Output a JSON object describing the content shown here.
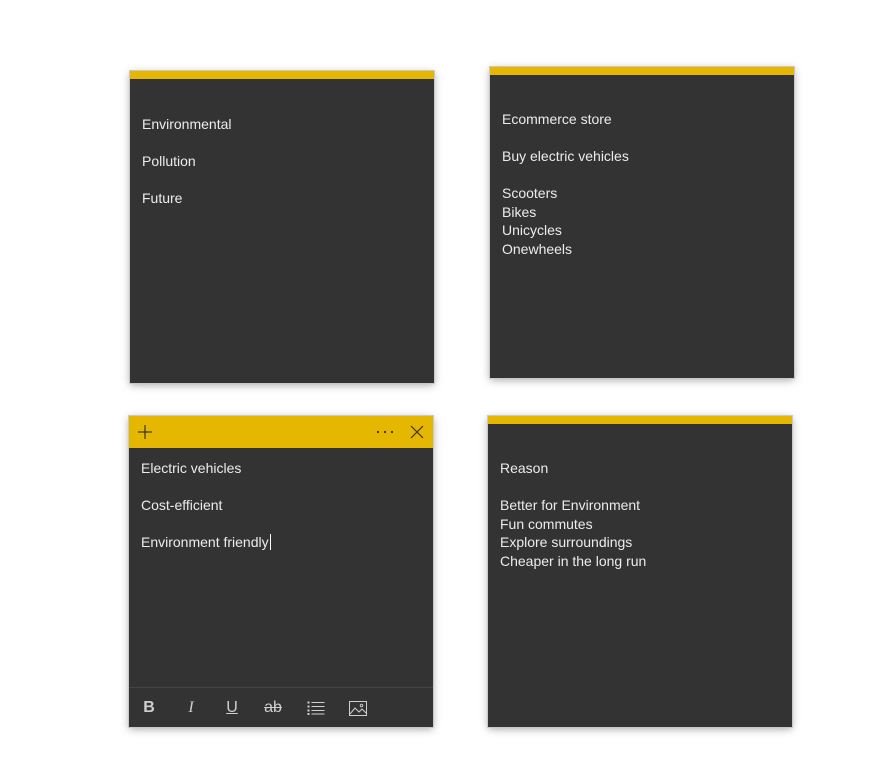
{
  "notes": [
    {
      "lines": [
        "Environmental",
        "",
        "Pollution",
        "",
        "Future"
      ]
    },
    {
      "lines": [
        "Ecommerce store",
        "",
        "Buy electric vehicles",
        "",
        "Scooters",
        "Bikes",
        "Unicycles",
        "Onewheels"
      ]
    },
    {
      "lines": [
        "Electric vehicles",
        "",
        "Cost-efficient",
        "",
        "Environment friendly"
      ]
    },
    {
      "lines": [
        "Reason",
        "",
        "Better for Environment",
        "Fun commutes",
        "Explore surroundings",
        "Cheaper in the long run"
      ]
    }
  ],
  "toolbar": {
    "bold": "B",
    "italic": "I",
    "underline": "U",
    "strikethrough": "ab"
  },
  "colors": {
    "accent": "#e5b700",
    "note_bg": "#333333",
    "text": "#ececec"
  },
  "icons": {
    "new_note": "plus-icon",
    "menu": "more-icon",
    "close": "close-icon",
    "bullets": "bullet-list-icon",
    "image": "image-icon"
  }
}
